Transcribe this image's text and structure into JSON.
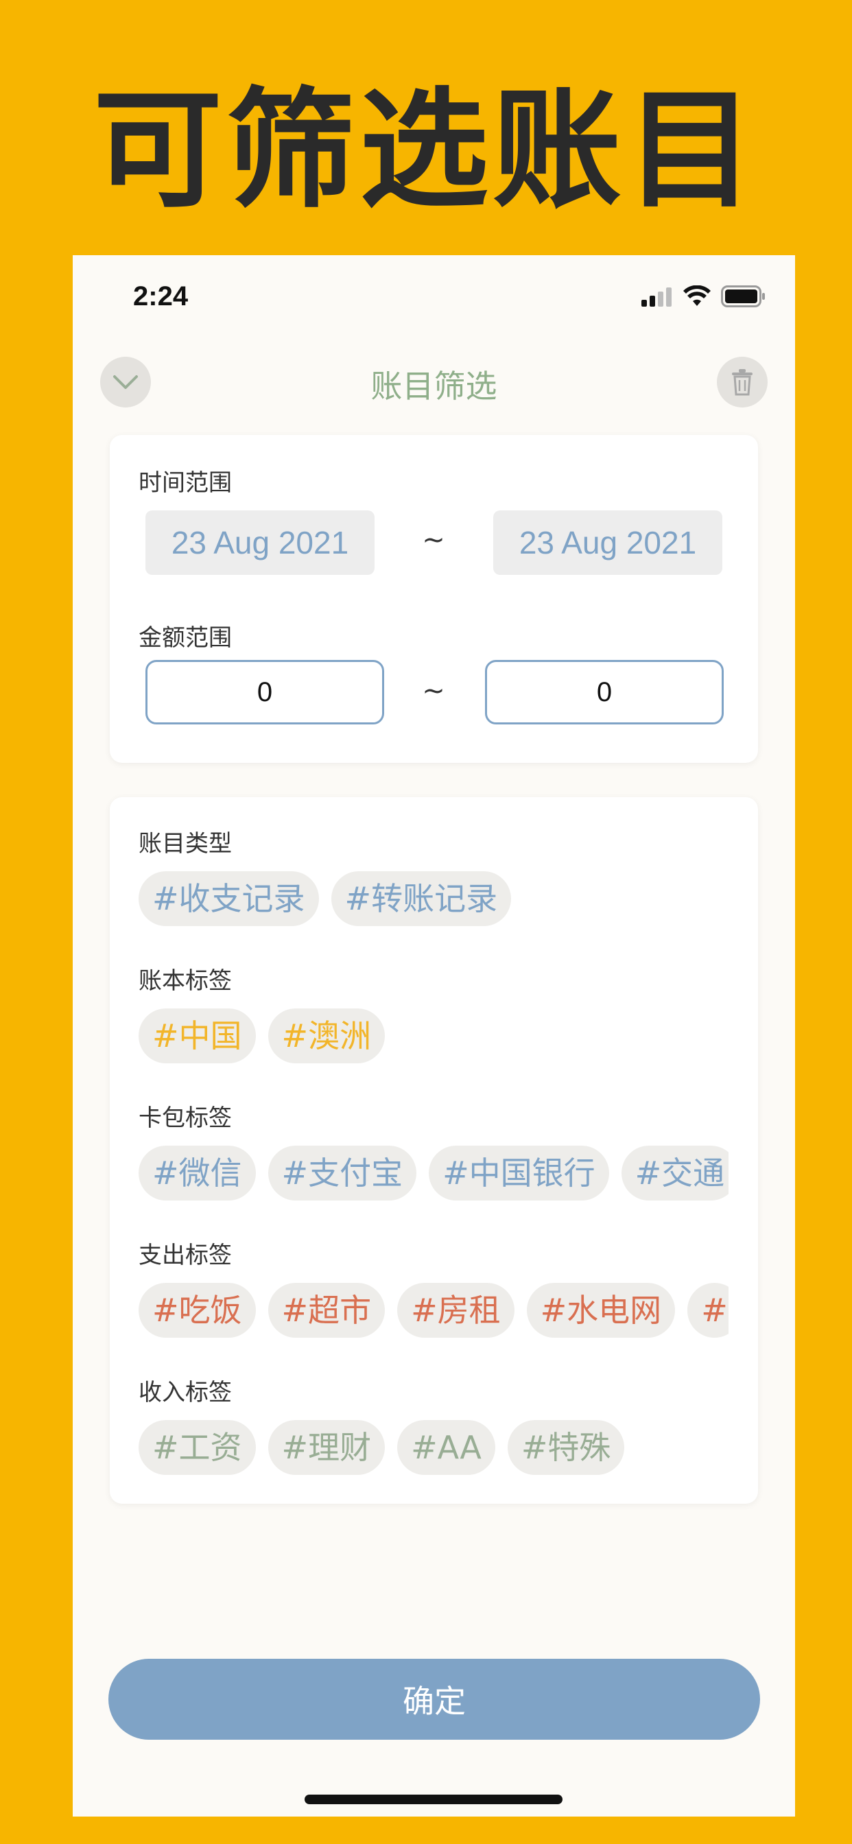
{
  "promo": {
    "title": "可筛选账目"
  },
  "status_bar": {
    "time": "2:24"
  },
  "nav": {
    "title": "账目筛选",
    "back_icon": "chevron-down-icon",
    "delete_icon": "trash-icon"
  },
  "time_range": {
    "label": "时间范围",
    "start_date": "23 Aug 2021",
    "separator": "~",
    "end_date": "23 Aug 2021"
  },
  "amount_range": {
    "label": "金额范围",
    "min_value": "0",
    "separator": "~",
    "max_value": "0"
  },
  "entry_type": {
    "label": "账目类型",
    "tags": [
      "#收支记录",
      "#转账记录"
    ]
  },
  "ledger_tags": {
    "label": "账本标签",
    "tags": [
      "#中国",
      "#澳洲"
    ]
  },
  "wallet_tags": {
    "label": "卡包标签",
    "tags": [
      "#微信",
      "#支付宝",
      "#中国银行",
      "#交通"
    ]
  },
  "expense_tags": {
    "label": "支出标签",
    "tags": [
      "#吃饭",
      "#超市",
      "#房租",
      "#水电网",
      "#"
    ]
  },
  "income_tags": {
    "label": "收入标签",
    "tags": [
      "#工资",
      "#理财",
      "#AA",
      "#特殊"
    ]
  },
  "confirm": {
    "label": "确定"
  },
  "colors": {
    "background": "#F7B500",
    "accent_blue": "#7FA3C6",
    "accent_yellow": "#F2B52A",
    "accent_red": "#D96F50",
    "accent_green": "#98AD94"
  }
}
